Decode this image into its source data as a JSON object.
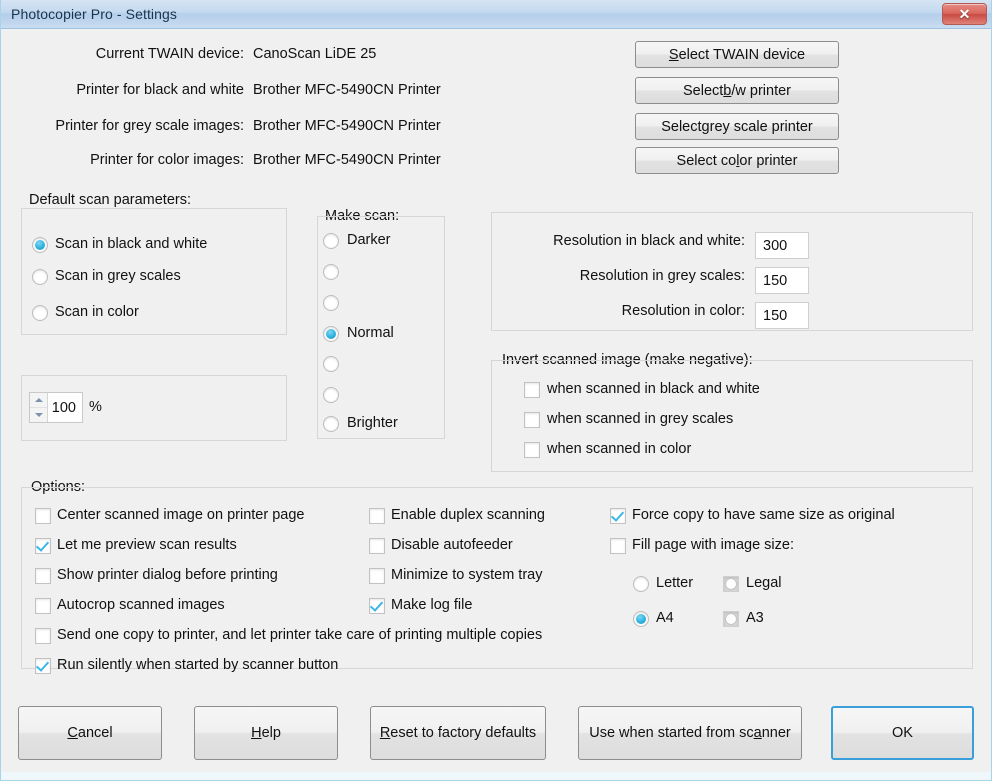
{
  "window": {
    "title": "Photocopier Pro - Settings",
    "close_icon": "close-icon",
    "accent_blue": "#3a9fd8",
    "title_bar_color": "#c3d8ef",
    "check_color": "#39b8e8",
    "radio_color": "#2fb3e0"
  },
  "device_info": [
    {
      "label": "Current TWAIN device:",
      "value": "CanoScan LiDE 25"
    },
    {
      "label": "Printer for black and white",
      "value": "Brother MFC-5490CN Printer"
    },
    {
      "label": "Printer for grey scale images:",
      "value": "Brother MFC-5490CN Printer"
    },
    {
      "label": "Printer for color images:",
      "value": "Brother MFC-5490CN Printer"
    }
  ],
  "device_buttons": [
    {
      "pre": "",
      "accel": "S",
      "post": "elect TWAIN device"
    },
    {
      "pre": "Select ",
      "accel": "b",
      "post": "/w printer"
    },
    {
      "pre": "Select ",
      "accel": "g",
      "post": "rey scale printer"
    },
    {
      "pre": "Select co",
      "accel": "l",
      "post": "or printer"
    }
  ],
  "default_scan": {
    "title": "Default scan parameters:",
    "options": [
      {
        "label": "Scan in black and white",
        "checked": true
      },
      {
        "label": "Scan in grey scales",
        "checked": false
      },
      {
        "label": "Scan in color",
        "checked": false
      }
    ],
    "zoom": {
      "value": "100",
      "unit": "%"
    }
  },
  "make_scan": {
    "title": "Make scan:",
    "steps": [
      {
        "label": "Darker",
        "checked": false
      },
      {
        "label": "",
        "checked": false
      },
      {
        "label": "",
        "checked": false
      },
      {
        "label": "Normal",
        "checked": true
      },
      {
        "label": "",
        "checked": false
      },
      {
        "label": "",
        "checked": false
      },
      {
        "label": "Brighter",
        "checked": false
      }
    ]
  },
  "resolution": {
    "rows": [
      {
        "label": "Resolution in black and white:",
        "value": "300"
      },
      {
        "label": "Resolution in grey scales:",
        "value": "150"
      },
      {
        "label": "Resolution in color:",
        "value": "150"
      }
    ]
  },
  "invert": {
    "title": "Invert scanned image (make negative):",
    "items": [
      {
        "label": "when scanned in black and white",
        "checked": false
      },
      {
        "label": "when scanned in grey scales",
        "checked": false
      },
      {
        "label": "when scanned in color",
        "checked": false
      }
    ]
  },
  "options": {
    "title": "Options:",
    "column1": [
      {
        "label": "Center scanned image on printer page",
        "checked": false
      },
      {
        "label": "Let me preview scan results",
        "checked": true
      },
      {
        "label": "Show printer dialog before printing",
        "checked": false
      },
      {
        "label": "Autocrop scanned images",
        "checked": false
      },
      {
        "label": "Send one copy to printer, and let printer take care of printing multiple copies",
        "checked": false
      },
      {
        "label": "Run silently when started by scanner button",
        "checked": true
      }
    ],
    "column2": [
      {
        "label": "Enable duplex scanning",
        "checked": false
      },
      {
        "label": "Disable autofeeder",
        "checked": false
      },
      {
        "label": "Minimize to system tray",
        "checked": false
      },
      {
        "label": "Make log file",
        "checked": true
      }
    ],
    "column3": [
      {
        "label": "Force copy to have same size as original",
        "checked": true
      },
      {
        "label": "Fill page with image size:",
        "checked": false
      }
    ],
    "page_sizes": [
      {
        "label": "Letter",
        "checked": false,
        "style": "plain"
      },
      {
        "label": "Legal",
        "checked": false,
        "style": "boxed"
      },
      {
        "label": "A4",
        "checked": true,
        "style": "plain"
      },
      {
        "label": "A3",
        "checked": false,
        "style": "boxed"
      }
    ]
  },
  "footer_buttons": [
    {
      "pre": "",
      "accel": "C",
      "post": "ancel",
      "default": false
    },
    {
      "pre": "",
      "accel": "H",
      "post": "elp",
      "default": false
    },
    {
      "pre": "",
      "accel": "R",
      "post": "eset to factory defaults",
      "default": false
    },
    {
      "pre": "Use when started from sc",
      "accel": "a",
      "post": "nner",
      "default": false
    },
    {
      "pre": "OK",
      "accel": "",
      "post": "",
      "default": true
    }
  ]
}
